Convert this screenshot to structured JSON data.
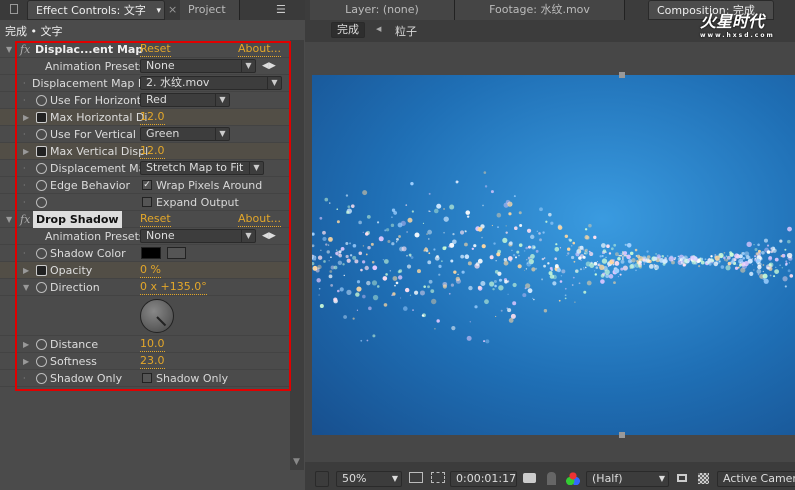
{
  "left_tabs": {
    "effect_controls": "Effect Controls: 文字",
    "project": "Project",
    "close": "×",
    "menu": "▾"
  },
  "breadcrumb": "完成 • 文字",
  "effects": [
    {
      "name": "Displac...ent Map",
      "reset": "Reset",
      "about": "About...",
      "presets_label": "Animation Presets:",
      "presets_value": "None",
      "props": [
        {
          "label": "Displacement Map La",
          "type": "dropdown",
          "value": "2. 水纹.mov"
        },
        {
          "label": "Use For Horizont",
          "type": "dropdown",
          "value": "Red"
        },
        {
          "label": "Max Horizontal Di",
          "type": "number",
          "value": "12.0"
        },
        {
          "label": "Use For Vertical",
          "type": "dropdown",
          "value": "Green"
        },
        {
          "label": "Max Vertical Displ",
          "type": "number",
          "value": "12.0"
        },
        {
          "label": "Displacement Ma",
          "type": "dropdown",
          "value": "Stretch Map to Fit"
        },
        {
          "label": "Edge Behavior",
          "type": "checkbox",
          "checked": true,
          "value": "Wrap Pixels Around"
        },
        {
          "label": "",
          "type": "checkbox",
          "checked": false,
          "value": "Expand Output"
        }
      ]
    },
    {
      "name": "Drop Shadow",
      "reset": "Reset",
      "about": "About...",
      "presets_label": "Animation Presets:",
      "presets_value": "None",
      "props": [
        {
          "label": "Shadow Color",
          "type": "color",
          "value": "#000000"
        },
        {
          "label": "Opacity",
          "type": "number",
          "value": "0 %"
        },
        {
          "label": "Direction",
          "type": "angle",
          "value": "0 x +135.0°"
        },
        {
          "label": "Distance",
          "type": "number",
          "value": "10.0"
        },
        {
          "label": "Softness",
          "type": "number",
          "value": "23.0"
        },
        {
          "label": "Shadow Only",
          "type": "checkbox",
          "checked": false,
          "value": "Shadow Only"
        }
      ]
    }
  ],
  "right_tabs": {
    "layer": "Layer: (none)",
    "footage": "Footage: 水纹.mov",
    "composition": "Composition: 完成"
  },
  "comp_nav": {
    "current": "完成",
    "next": "粒子"
  },
  "watermark": {
    "logo": "火星时代",
    "url": "www.hxsd.com"
  },
  "bottom_bar": {
    "zoom": "50%",
    "timecode": "0:00:01:17",
    "resolution": "(Half)",
    "camera": "Active Camera"
  },
  "colors": {
    "accent": "#e3a72a",
    "highlight_box": "#e00000",
    "comp_bg": "#1f6fb5"
  }
}
